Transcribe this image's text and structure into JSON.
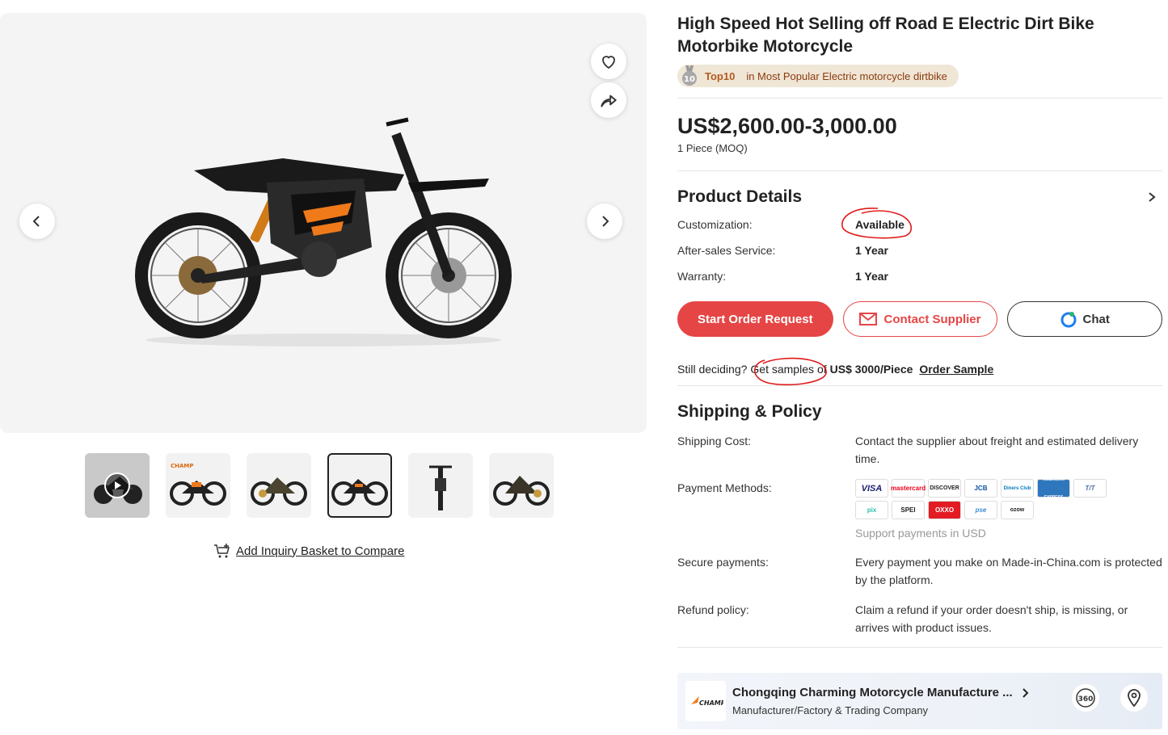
{
  "product": {
    "title": "High Speed Hot Selling off Road E Electric Dirt Bike Motorbike Motorcycle",
    "rank_badge": "Top10",
    "rank_medal_number": "10",
    "rank_text": "in Most Popular Electric motorcycle dirtbike",
    "price": "US$2,600.00-3,000.00",
    "moq": "1 Piece (MOQ)"
  },
  "gallery": {
    "thumbnail_count": 6,
    "active_thumbnail_index": 3,
    "brand_mark": "CHAMP",
    "compare_link": "Add Inquiry Basket to Compare"
  },
  "details": {
    "title": "Product Details",
    "rows": [
      {
        "label": "Customization:",
        "value": "Available"
      },
      {
        "label": "After-sales Service:",
        "value": "1 Year"
      },
      {
        "label": "Warranty:",
        "value": "1 Year"
      }
    ]
  },
  "actions": {
    "start_order": "Start Order Request",
    "contact_supplier": "Contact Supplier",
    "chat": "Chat"
  },
  "sample": {
    "prefix": "Still deciding?",
    "link_text": "Get samples",
    "middle": "of",
    "price": "US$ 3000/Piece",
    "order_link": "Order Sample"
  },
  "shipping": {
    "title": "Shipping & Policy",
    "shipping_cost_label": "Shipping Cost:",
    "shipping_cost_value": "Contact the supplier about freight and estimated delivery time.",
    "payment_label": "Payment Methods:",
    "payment_methods": [
      "VISA",
      "mastercard",
      "DISCOVER",
      "JCB",
      "Diners Club",
      "AMERICAN EXPRESS",
      "T/T",
      "pix",
      "SPEI",
      "OXXO",
      "pse",
      "ozow"
    ],
    "payment_note": "Support payments in USD",
    "secure_label": "Secure payments:",
    "secure_value": "Every payment you make on Made-in-China.com is protected by the platform.",
    "refund_label": "Refund policy:",
    "refund_value": "Claim a refund if your order doesn't ship, is missing, or arrives with product issues."
  },
  "supplier": {
    "name": "Chongqing Charming Motorcycle Manufacture ...",
    "type": "Manufacturer/Factory & Trading Company",
    "tour_label": "360"
  },
  "colors": {
    "accent_red": "#e64545",
    "bike_orange": "#f07a1a",
    "rank_bg": "#f0e6d6"
  }
}
